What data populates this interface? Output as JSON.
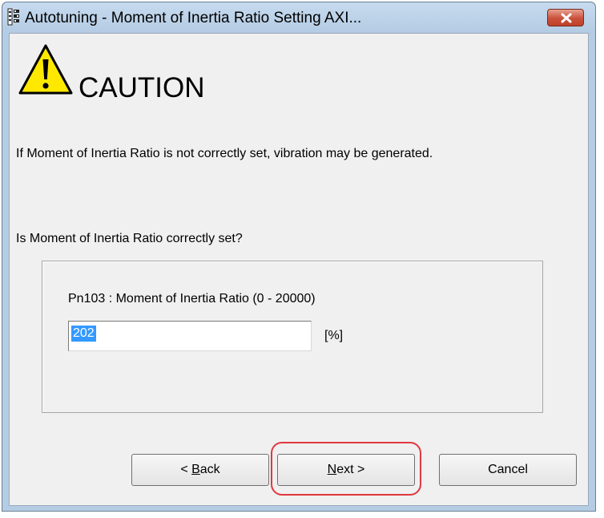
{
  "window": {
    "title": "Autotuning - Moment of Inertia Ratio Setting AXI...",
    "app_icon": "app-icon",
    "close_icon": "close-icon"
  },
  "caution": {
    "icon": "warning-triangle-icon",
    "heading": "CAUTION",
    "message": "If Moment of Inertia Ratio is not correctly set, vibration may be generated.",
    "question": "Is Moment of Inertia Ratio correctly set?"
  },
  "parameter": {
    "label": "Pn103 : Moment of Inertia Ratio (0 - 20000)",
    "value": "202",
    "unit": "[%]"
  },
  "buttons": {
    "back_prefix": "< ",
    "back_mnemonic": "B",
    "back_rest": "ack",
    "next_mnemonic": "N",
    "next_rest": "ext >",
    "cancel": "Cancel"
  },
  "colors": {
    "highlight": "#e0393e",
    "selection": "#3399ff",
    "warning": "#ffe800"
  }
}
